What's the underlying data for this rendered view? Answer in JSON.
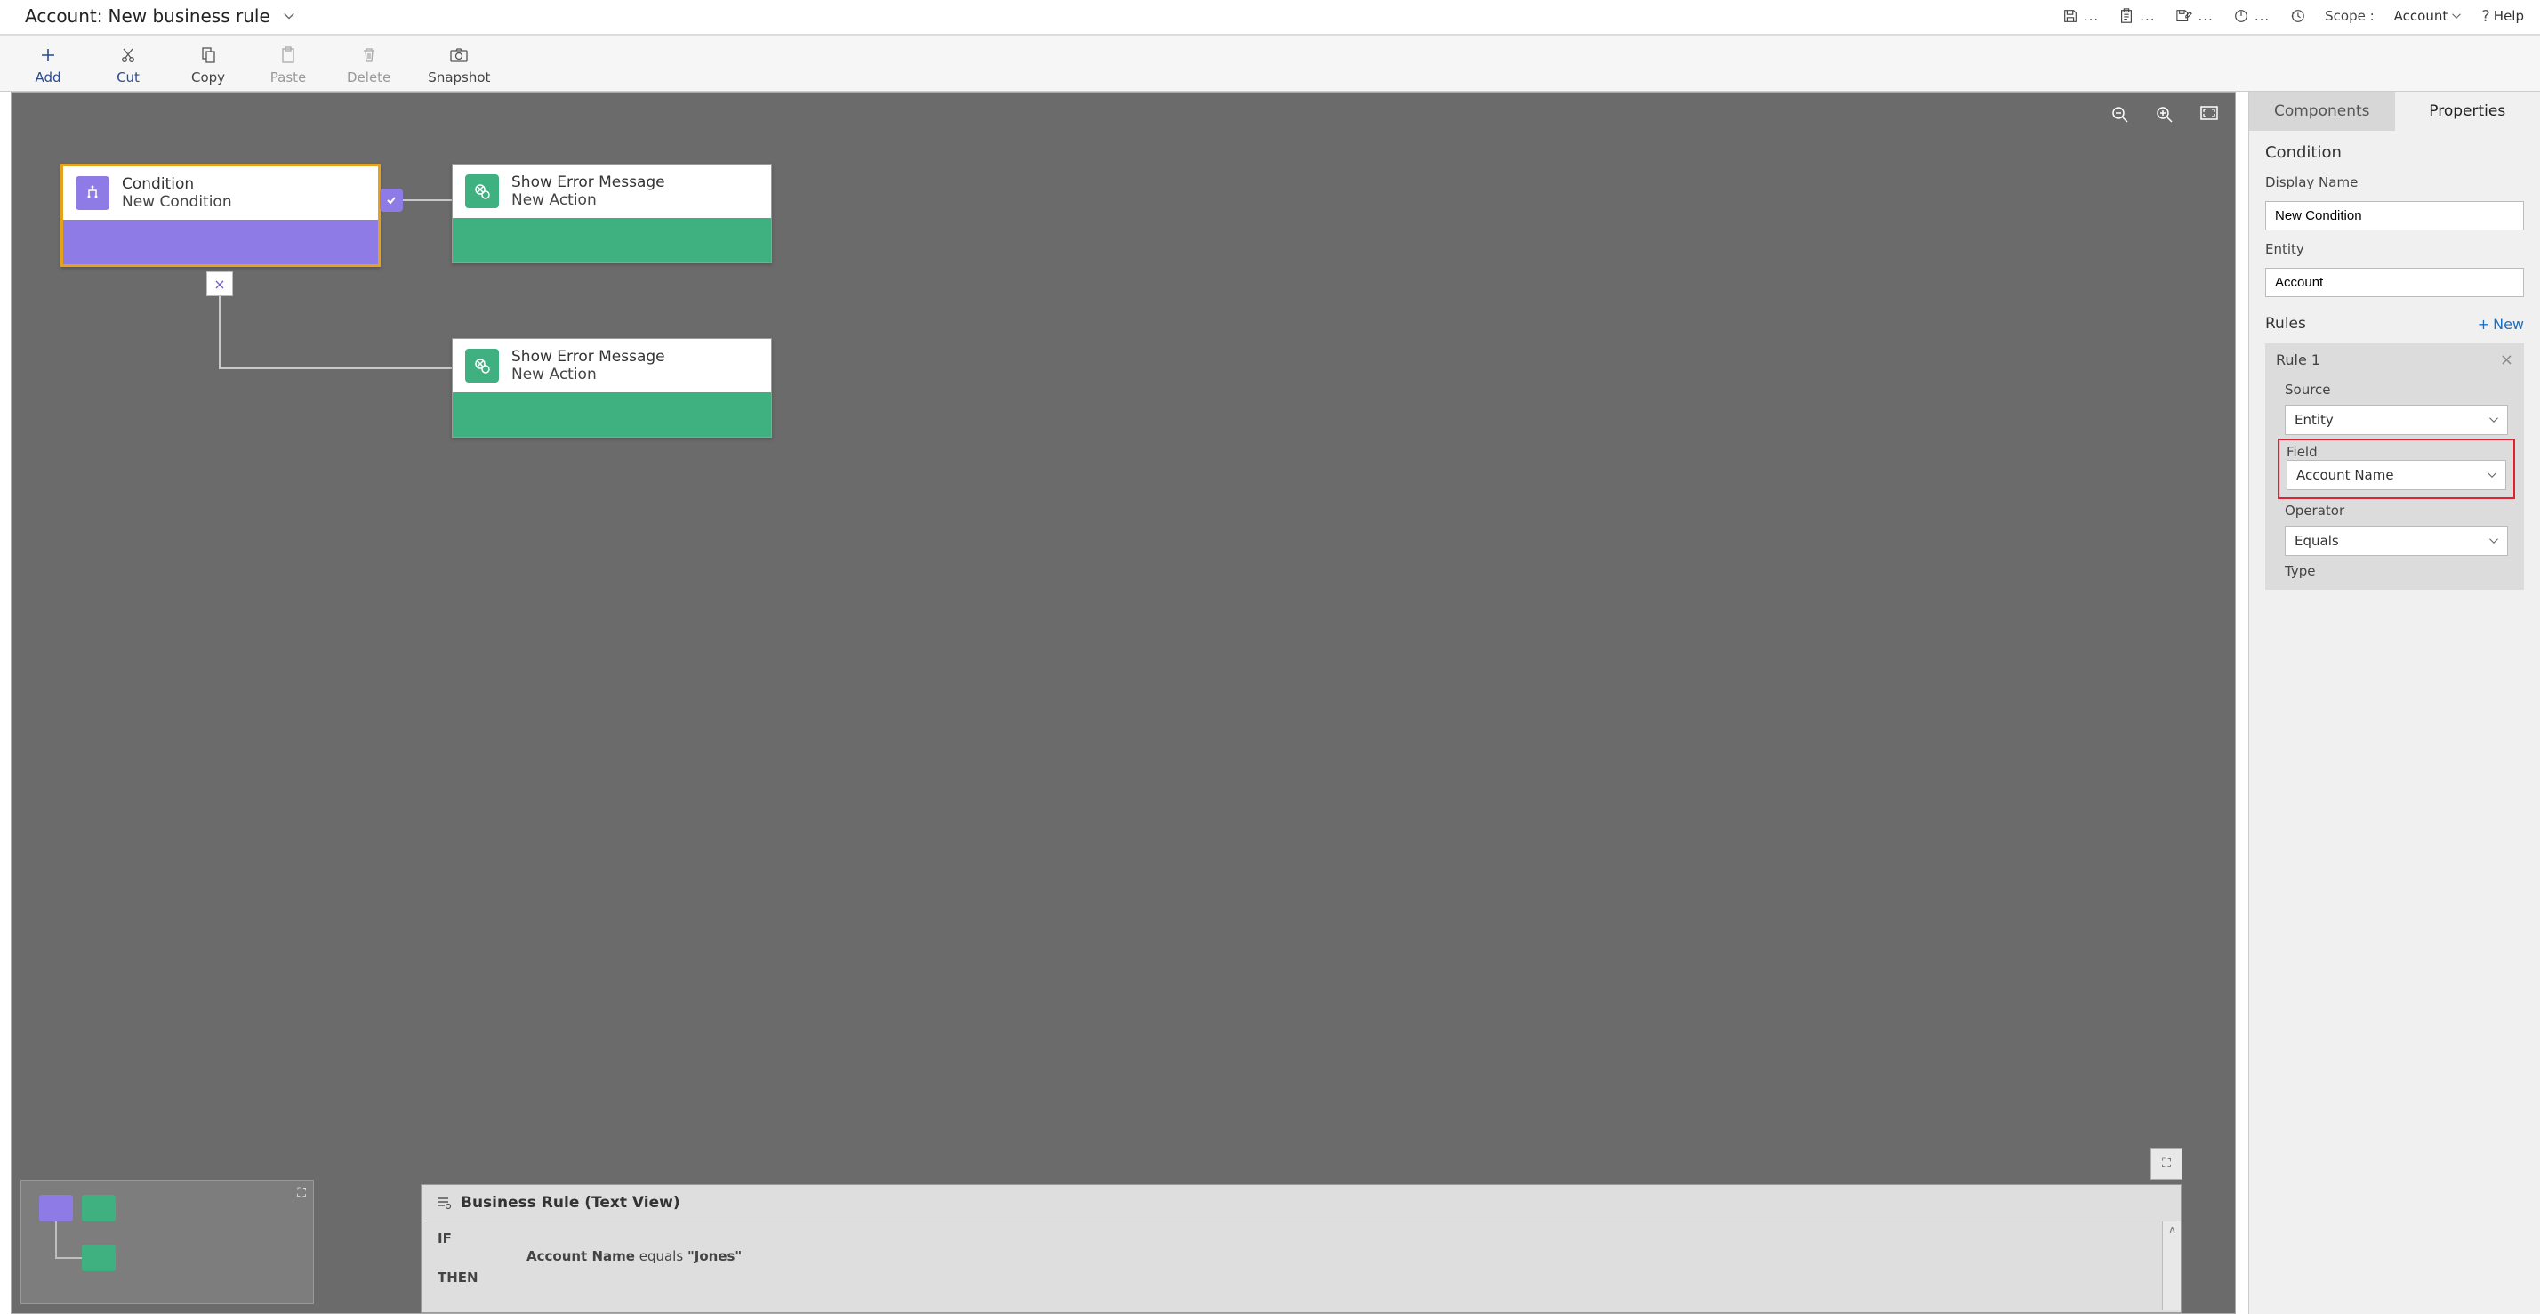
{
  "header": {
    "prefix": "Account:",
    "title": "New business rule",
    "scope_label": "Scope :",
    "scope_value": "Account",
    "help": "Help"
  },
  "toolbar": {
    "add": "Add",
    "cut": "Cut",
    "copy": "Copy",
    "paste": "Paste",
    "delete": "Delete",
    "snapshot": "Snapshot"
  },
  "nodes": {
    "condition": {
      "title": "Condition",
      "subtitle": "New Condition"
    },
    "action1": {
      "title": "Show Error Message",
      "subtitle": "New Action"
    },
    "action2": {
      "title": "Show Error Message",
      "subtitle": "New Action"
    }
  },
  "textview": {
    "title": "Business Rule (Text View)",
    "if": "IF",
    "then": "THEN",
    "cond_field": "Account Name",
    "cond_op": "equals",
    "cond_val": "\"Jones\""
  },
  "side": {
    "tab_components": "Components",
    "tab_properties": "Properties",
    "section": "Condition",
    "display_name_label": "Display Name",
    "display_name_value": "New Condition",
    "entity_label": "Entity",
    "entity_value": "Account",
    "rules_label": "Rules",
    "rules_new": "New",
    "rule_title": "Rule 1",
    "source_label": "Source",
    "source_value": "Entity",
    "field_label": "Field",
    "field_value": "Account Name",
    "operator_label": "Operator",
    "operator_value": "Equals",
    "type_label": "Type"
  }
}
